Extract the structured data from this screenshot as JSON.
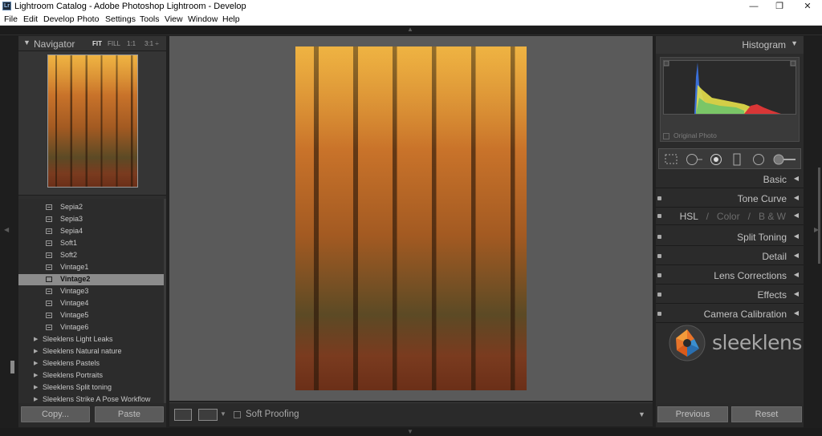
{
  "window": {
    "title": "Lightroom Catalog - Adobe Photoshop Lightroom - Develop",
    "app_icon_text": "Lr",
    "minimize": "—",
    "maximize": "❐",
    "close": "✕"
  },
  "menu": [
    "File",
    "Edit",
    "Develop",
    "Photo",
    "Settings",
    "Tools",
    "View",
    "Window",
    "Help"
  ],
  "navigator": {
    "title": "Navigator",
    "zoom": [
      "FIT",
      "FILL",
      "1:1",
      "3:1 ÷"
    ]
  },
  "presets": {
    "items": [
      "Sepia2",
      "Sepia3",
      "Sepia4",
      "Soft1",
      "Soft2",
      "Vintage1",
      "Vintage2",
      "Vintage3",
      "Vintage4",
      "Vintage5",
      "Vintage6"
    ],
    "selected": "Vintage2",
    "folders": [
      "Sleeklens Light Leaks",
      "Sleeklens Natural nature",
      "Sleeklens Pastels",
      "Sleeklens Portraits",
      "Sleeklens Split toning",
      "Sleeklens Strike A Pose Workflow"
    ]
  },
  "left_buttons": {
    "copy": "Copy...",
    "paste": "Paste"
  },
  "toolbar": {
    "soft_proofing": "Soft Proofing"
  },
  "histogram": {
    "title": "Histogram",
    "original_photo": "Original Photo"
  },
  "sections": {
    "basic": "Basic",
    "tone_curve": "Tone Curve",
    "hsl": "HSL",
    "sep": "/",
    "color": "Color",
    "bw": "B & W",
    "split_toning": "Split Toning",
    "detail": "Detail",
    "lens_corrections": "Lens Corrections",
    "effects": "Effects",
    "camera_calibration": "Camera Calibration"
  },
  "logo": {
    "text": "sleeklens"
  },
  "right_buttons": {
    "previous": "Previous",
    "reset": "Reset"
  },
  "icons": [
    "lightroom-icon",
    "navigator-collapse-icon",
    "preset-icon",
    "folder-expand-icon",
    "loupe-view-icon",
    "before-after-icon",
    "histogram-collapse-icon",
    "crop-tool-icon",
    "spot-removal-icon",
    "red-eye-icon",
    "graduated-filter-icon",
    "radial-filter-icon",
    "adjustment-brush-icon",
    "section-collapse-icon",
    "sleeklens-logo-icon"
  ],
  "colors": {
    "panel": "#2e2e2e",
    "canvas": "#5a5a5a",
    "selected_row": "#8c8c8c",
    "text": "#c2c2c2"
  }
}
